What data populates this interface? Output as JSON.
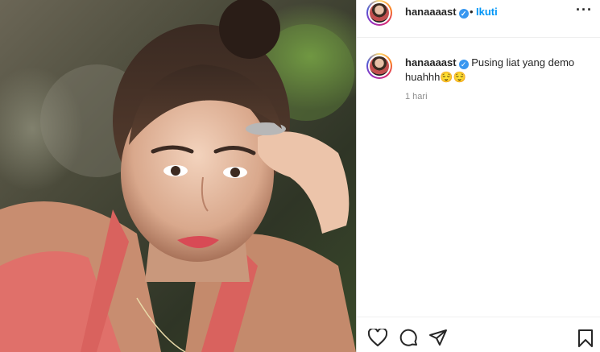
{
  "post": {
    "username": "hanaaaast",
    "verified_mark": "✓",
    "separator": "•",
    "follow_label": "Ikuti",
    "more_label": "···"
  },
  "caption": {
    "username": "hanaaaast",
    "text": "Pusing liat yang demo huahhh😌😌",
    "time": "1 hari"
  },
  "actions": {
    "like": "heart-icon",
    "comment": "comment-icon",
    "share": "paper-plane-icon",
    "save": "bookmark-icon"
  },
  "colors": {
    "link_blue": "#0095f6",
    "verified_blue": "#3897f0",
    "meta_gray": "#8e8e8e"
  }
}
